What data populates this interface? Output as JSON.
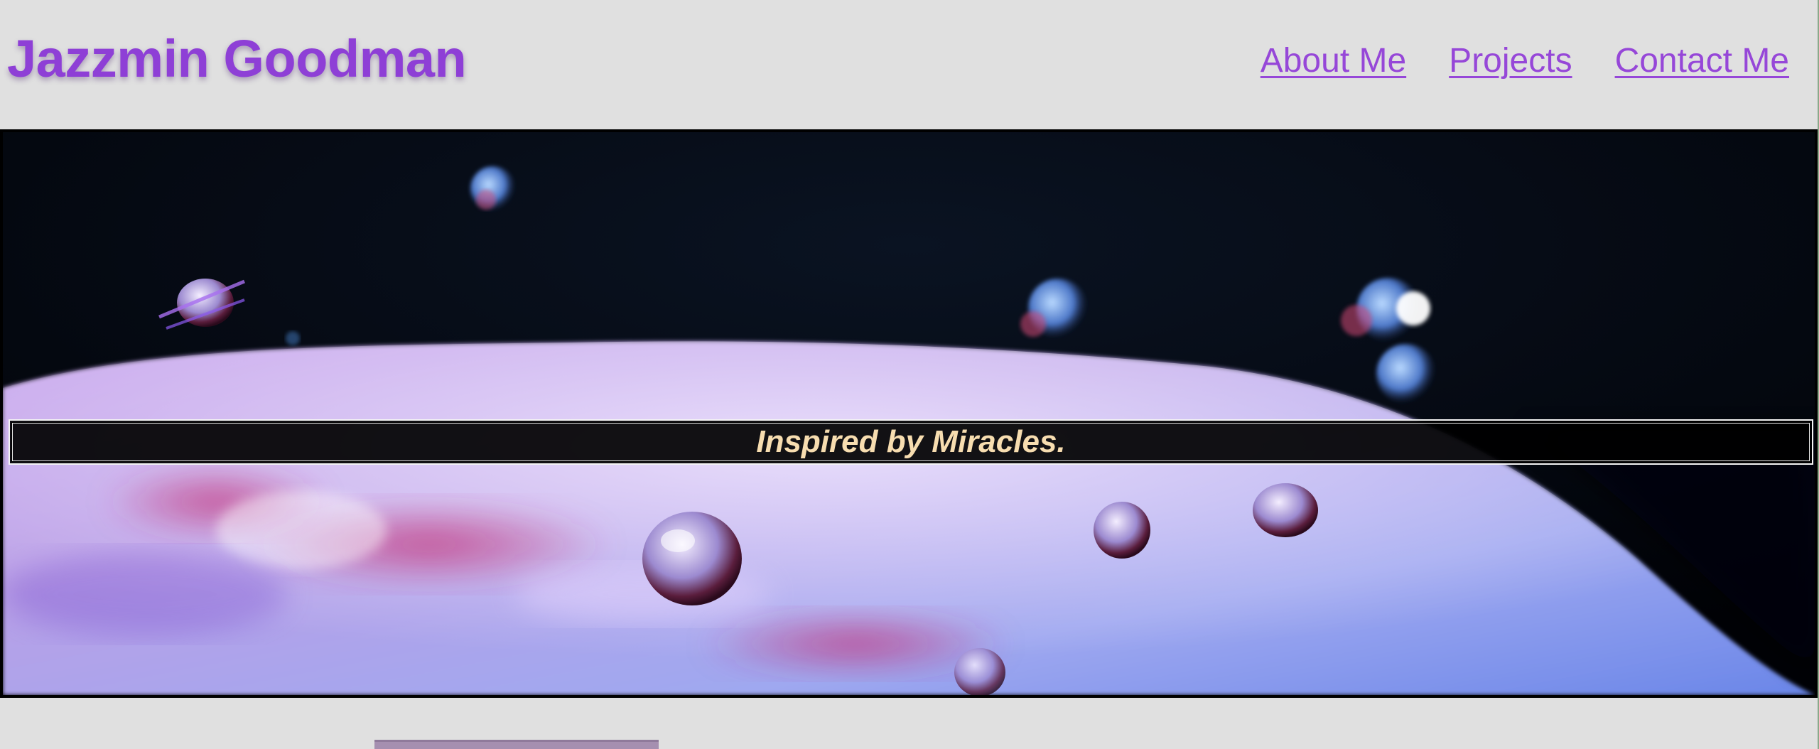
{
  "site": {
    "title": "Jazzmin Goodman"
  },
  "nav": {
    "items": [
      {
        "label": "About Me"
      },
      {
        "label": "Projects"
      },
      {
        "label": "Contact Me"
      }
    ]
  },
  "hero": {
    "tagline": "Inspired by Miracles."
  },
  "colors": {
    "accent": "#8e3fd6",
    "background": "#e0e0e0",
    "tagline_text": "#f7ddb0"
  }
}
